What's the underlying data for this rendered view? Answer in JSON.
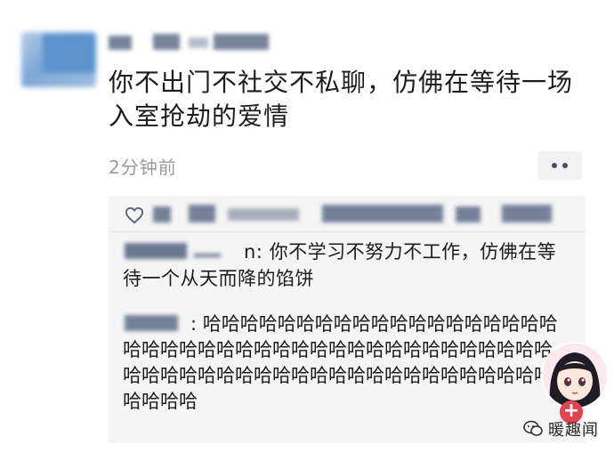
{
  "post": {
    "text": "你不出门不社交不私聊，仿佛在等待一场入室抢劫的爱情",
    "timestamp": "2分钟前"
  },
  "comments": [
    {
      "author_suffix": "n:",
      "text": "你不学习不努力不工作，仿佛在等待一个从天而降的馅饼"
    },
    {
      "author_suffix": ":",
      "text": "哈哈哈哈哈哈哈哈哈哈哈哈哈哈哈哈哈哈哈哈哈哈哈哈哈哈哈哈哈哈哈哈哈哈哈哈哈哈哈哈哈哈哈哈哈哈哈哈哈哈哈哈哈哈哈哈哈哈哈哈哈哈哈哈哈哈哈哈哈"
    }
  ],
  "watermark": {
    "text": "暖趣闻",
    "icon": "wechat-official-account-icon"
  },
  "badge": {
    "label": "+"
  },
  "icons": {
    "like": "heart-icon",
    "more": "more-dots-icon",
    "sticker": "anime-girl-sticker"
  },
  "colors": {
    "comment_bg": "#f5f5f5",
    "timestamp": "#9a9a9a",
    "badge": "#e24350"
  }
}
